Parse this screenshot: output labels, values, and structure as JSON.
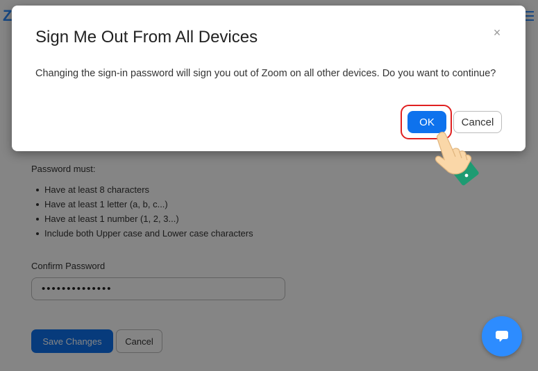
{
  "background": {
    "password_rules_title": "Password must:",
    "password_rules": [
      "Have at least 8 characters",
      "Have at least 1 letter (a, b, c...)",
      "Have at least 1 number (1, 2, 3...)",
      "Include both Upper case and Lower case characters"
    ],
    "confirm_label": "Confirm Password",
    "confirm_value": "••••••••••••••",
    "save_label": "Save Changes",
    "cancel_label": "Cancel"
  },
  "dialog": {
    "title": "Sign Me Out From All Devices",
    "close_glyph": "×",
    "message": "Changing the sign-in password will sign you out of Zoom on all other devices. Do you want to continue?",
    "ok_label": "OK",
    "cancel_label": "Cancel"
  },
  "colors": {
    "accent": "#0e72ed",
    "brand": "#2d8cff",
    "highlight": "#e02020"
  },
  "icons": {
    "close": "close-icon",
    "chat": "chat-bubble-icon",
    "hand": "pointing-hand-icon"
  }
}
